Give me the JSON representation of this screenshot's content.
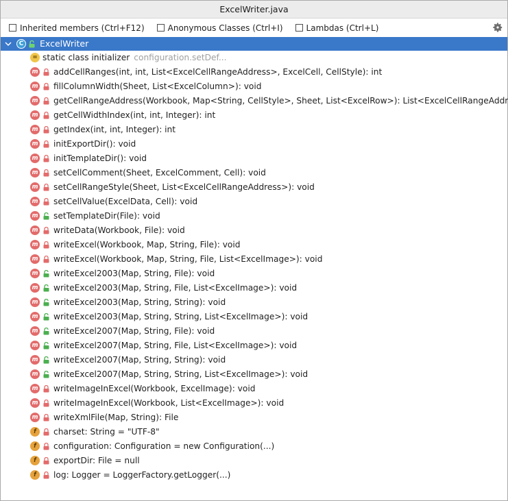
{
  "window": {
    "title": "ExcelWriter.java"
  },
  "toolbar": {
    "options": [
      {
        "label": "Inherited members (Ctrl+F12)",
        "checked": false
      },
      {
        "label": "Anonymous Classes (Ctrl+I)",
        "checked": false
      },
      {
        "label": "Lambdas (Ctrl+L)",
        "checked": false
      }
    ],
    "settings_icon": "gear-icon"
  },
  "tree": {
    "root": {
      "label": "ExcelWriter",
      "icon": "class-icon",
      "icon_letter": "C",
      "expanded": true,
      "selected_color": "#3a78c9"
    },
    "items": [
      {
        "kind": "static-initializer",
        "label": "static class initializer",
        "hint": "configuration.setDef...",
        "access": "none"
      },
      {
        "kind": "method",
        "label": "addCellRanges(int, int, List<ExcelCellRangeAddress>, ExcelCell, CellStyle): int",
        "access": "private"
      },
      {
        "kind": "method",
        "label": "fillColumnWidth(Sheet, List<ExcelColumn>): void",
        "access": "private"
      },
      {
        "kind": "method",
        "label": "getCellRangeAddress(Workbook, Map<String, CellStyle>, Sheet, List<ExcelRow>): List<ExcelCellRangeAddress>",
        "access": "private"
      },
      {
        "kind": "method",
        "label": "getCellWidthIndex(int, int, Integer): int",
        "access": "private"
      },
      {
        "kind": "method",
        "label": "getIndex(int, int, Integer): int",
        "access": "private"
      },
      {
        "kind": "method",
        "label": "initExportDir(): void",
        "access": "private"
      },
      {
        "kind": "method",
        "label": "initTemplateDir(): void",
        "access": "private"
      },
      {
        "kind": "method",
        "label": "setCellComment(Sheet, ExcelComment, Cell): void",
        "access": "private"
      },
      {
        "kind": "method",
        "label": "setCellRangeStyle(Sheet, List<ExcelCellRangeAddress>): void",
        "access": "private"
      },
      {
        "kind": "method",
        "label": "setCellValue(ExcelData, Cell): void",
        "access": "private"
      },
      {
        "kind": "method",
        "label": "setTemplateDir(File): void",
        "access": "public"
      },
      {
        "kind": "method",
        "label": "writeData(Workbook, File): void",
        "access": "private"
      },
      {
        "kind": "method",
        "label": "writeExcel(Workbook, Map, String, File): void",
        "access": "private"
      },
      {
        "kind": "method",
        "label": "writeExcel(Workbook, Map, String, File, List<ExcelImage>): void",
        "access": "private"
      },
      {
        "kind": "method",
        "label": "writeExcel2003(Map, String, File): void",
        "access": "public"
      },
      {
        "kind": "method",
        "label": "writeExcel2003(Map, String, File, List<ExcelImage>): void",
        "access": "public"
      },
      {
        "kind": "method",
        "label": "writeExcel2003(Map, String, String): void",
        "access": "public"
      },
      {
        "kind": "method",
        "label": "writeExcel2003(Map, String, String, List<ExcelImage>): void",
        "access": "public"
      },
      {
        "kind": "method",
        "label": "writeExcel2007(Map, String, File): void",
        "access": "public"
      },
      {
        "kind": "method",
        "label": "writeExcel2007(Map, String, File, List<ExcelImage>): void",
        "access": "public"
      },
      {
        "kind": "method",
        "label": "writeExcel2007(Map, String, String): void",
        "access": "public"
      },
      {
        "kind": "method",
        "label": "writeExcel2007(Map, String, String, List<ExcelImage>): void",
        "access": "public"
      },
      {
        "kind": "method",
        "label": "writeImageInExcel(Workbook, ExcelImage): void",
        "access": "private"
      },
      {
        "kind": "method",
        "label": "writeImageInExcel(Workbook, List<ExcelImage>): void",
        "access": "private"
      },
      {
        "kind": "method",
        "label": "writeXmlFile(Map, String): File",
        "access": "private"
      },
      {
        "kind": "field",
        "label": "charset: String = \"UTF-8\"",
        "access": "private"
      },
      {
        "kind": "field",
        "label": "configuration: Configuration = new Configuration(...)",
        "access": "private"
      },
      {
        "kind": "field",
        "label": "exportDir: File = null",
        "access": "private"
      },
      {
        "kind": "field",
        "label": "log: Logger = LoggerFactory.getLogger(...)",
        "access": "private"
      }
    ]
  },
  "colors": {
    "selection": "#3a78c9",
    "method_icon": "#e36b6b",
    "field_icon": "#e6a23c",
    "private_lock": "#e36b6b",
    "public_lock": "#4caf50",
    "hint_text": "#a0a0a0"
  }
}
